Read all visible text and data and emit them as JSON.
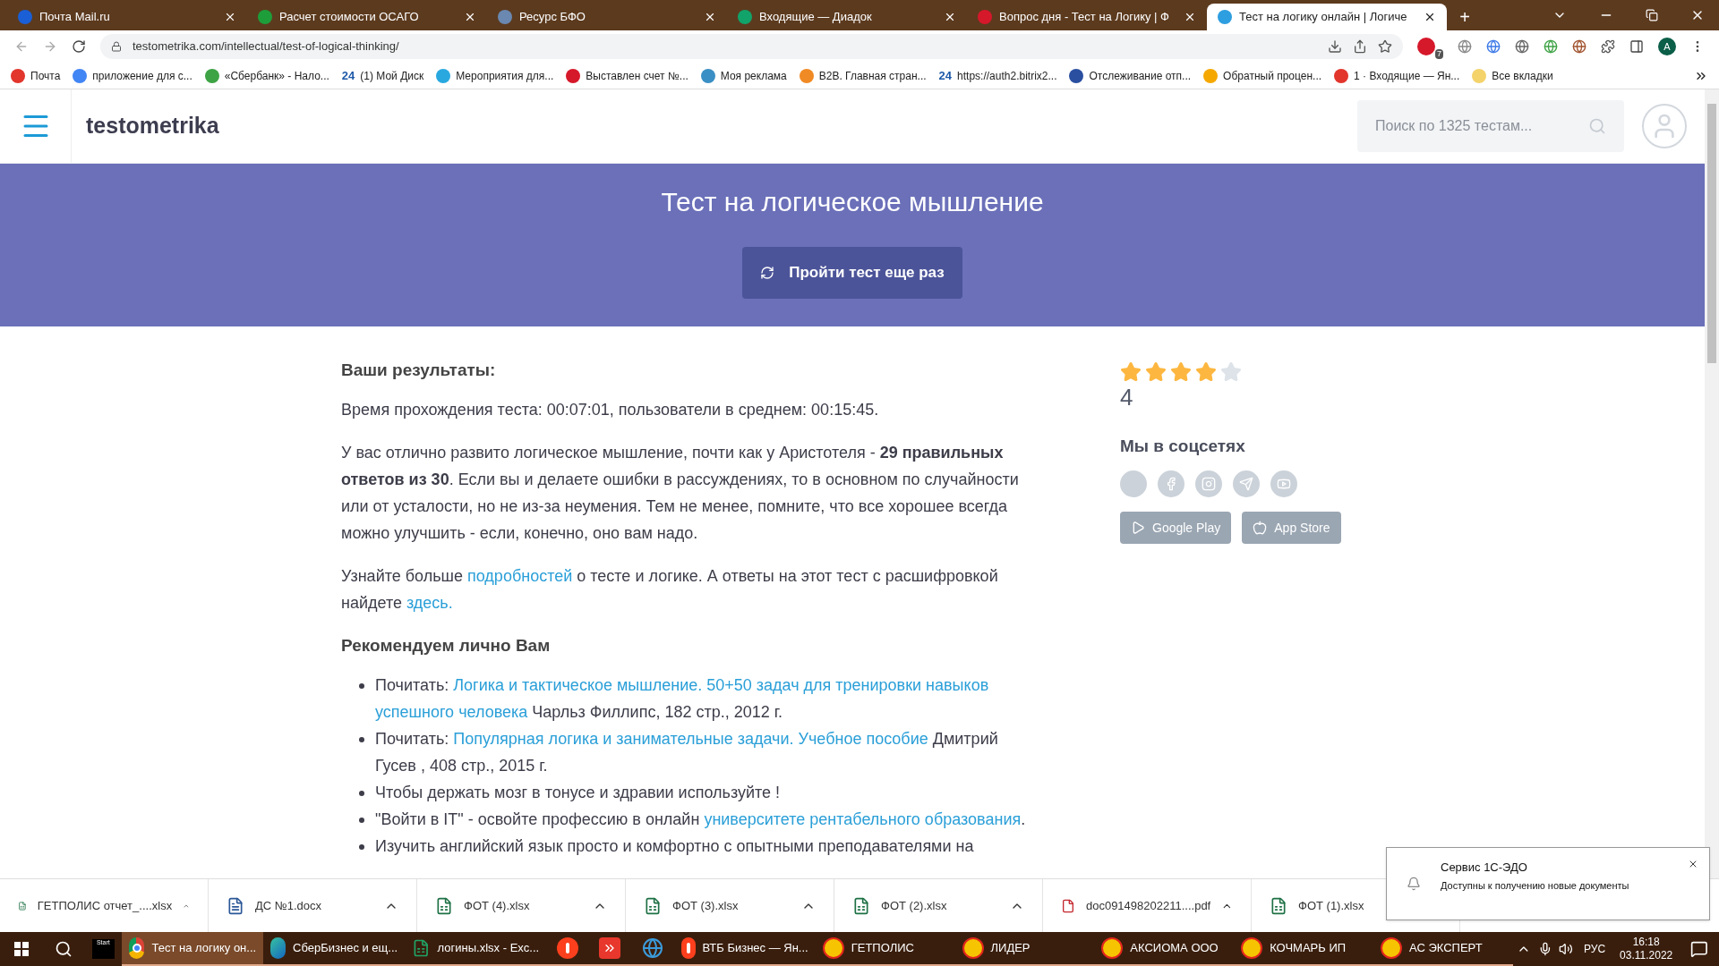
{
  "browser": {
    "tabs": [
      {
        "title": "Почта Mail.ru",
        "color": "#1a5fd6",
        "selected": false
      },
      {
        "title": "Расчет стоимости ОСАГО",
        "color": "#1e9e3a",
        "selected": false
      },
      {
        "title": "Ресурс БФО",
        "color": "#6a88b0",
        "selected": false
      },
      {
        "title": "Входящие — Диадок",
        "color": "#12a36a",
        "selected": false
      },
      {
        "title": "Вопрос дня - Тест на Логику | Ф",
        "color": "#d6182b",
        "selected": false
      },
      {
        "title": "Тест на логику онлайн | Логиче",
        "color": "#2d9ee0",
        "selected": true
      }
    ],
    "new_tab": "+",
    "url": "testometrika.com/intellectual/test-of-logical-thinking/",
    "profile": "A",
    "extension_badge": "7",
    "bookmarks": [
      {
        "label": "Почта",
        "color": "#e2352c"
      },
      {
        "label": "приложение для с...",
        "color": "#4285f4"
      },
      {
        "label": "«Сбербанк» - Нало...",
        "color": "#3da344"
      },
      {
        "label": "(1) Мой Диск",
        "color": "#1e5aa8",
        "glyph": "24"
      },
      {
        "label": "Мероприятия для...",
        "color": "#29a8e0"
      },
      {
        "label": "Выставлен счет №...",
        "color": "#d6182b"
      },
      {
        "label": "Моя реклама",
        "color": "#3a8fc4"
      },
      {
        "label": "B2B. Главная стран...",
        "color": "#f08a24"
      },
      {
        "label": "https://auth2.bitrix2...",
        "color": "#1e5aa8",
        "glyph": "24"
      },
      {
        "label": "Отслеживание отп...",
        "color": "#2a4fa0"
      },
      {
        "label": "Обратный процен...",
        "color": "#f5a800"
      },
      {
        "label": "1 · Входящие — Ян...",
        "color": "#e2352c"
      },
      {
        "label": "Все вкладки",
        "color": "#f4d36b"
      }
    ]
  },
  "site": {
    "logo": "testometrika",
    "search": {
      "placeholder": "Поиск по 1325 тестам..."
    },
    "banner": {
      "title": "Тест на логическое мышление",
      "button": "Пройти тест еще раз"
    },
    "results": {
      "heading": "Ваши результаты:",
      "time": "Время прохождения теста: 00:07:01, пользователи в среднем: 00:15:45.",
      "summary": "У вас отлично развито логическое мышление, почти как у Аристотеля - **29 правильных ответов из 30**. Если вы и делаете ошибки в рассуждениях, то в основном по случайности или от усталости, но не из-за неумения. Тем не менее, помните, что все хорошее всегда можно улучшить - если, конечно, оно вам надо.",
      "more": [
        {
          "text": "Узнайте больше "
        },
        {
          "text": "подробностей",
          "link": true
        },
        {
          "text": " о тесте и логике. А ответы на этот тест с расшифровкой найдете "
        },
        {
          "text": "здесь.",
          "link": true
        }
      ]
    },
    "recommend": {
      "heading": "Рекомендуем лично Вам",
      "items": [
        [
          {
            "text": "Почитать: "
          },
          {
            "text": "Логика и тактическое мышление. 50+50 задач для тренировки навыков ",
            "link": true
          },
          {
            "text": "успешного человека",
            "link": true
          },
          {
            "text": " Чарльз Филлипс, 182 стр., 2012 г."
          }
        ],
        [
          {
            "text": "Почитать: "
          },
          {
            "text": "Популярная логика и занимательные задачи. Учебное пособие",
            "link": true
          },
          {
            "text": " Дмитрий Гусев , 408 стр., 2015 г."
          }
        ],
        [
          {
            "text": "Чтобы держать мозг в тонусе и здравии используйте !"
          }
        ],
        [
          {
            "text": "\"Войти в IT\" - освойте профессию в онлайн "
          },
          {
            "text": "университете рентабельного образования",
            "link": true
          },
          {
            "text": "."
          }
        ],
        [
          {
            "text": "Изучить английский язык просто и комфортно с опытными преподавателями на"
          }
        ]
      ]
    },
    "sidebar": {
      "stars": 4,
      "rating": "4",
      "social_heading": "Мы в соцсетях",
      "store_buttons": [
        "Google Play",
        "App Store"
      ]
    }
  },
  "downloads": [
    {
      "name": "ГЕТПОЛИС отчет_....xlsx",
      "kind": "xlsx"
    },
    {
      "name": "ДС №1.docx",
      "kind": "docx"
    },
    {
      "name": "ФОТ (4).xlsx",
      "kind": "xlsx"
    },
    {
      "name": "ФОТ (3).xlsx",
      "kind": "xlsx"
    },
    {
      "name": "ФОТ (2).xlsx",
      "kind": "xlsx"
    },
    {
      "name": "doc091498202211....pdf",
      "kind": "pdf"
    },
    {
      "name": "ФОТ (1).xlsx",
      "kind": "xlsx"
    }
  ],
  "notification": {
    "title": "Сервис 1С-ЭДО",
    "body": "Доступны к получению новые документы"
  },
  "taskbar": {
    "start_app": "Start",
    "apps": [
      {
        "label": "Тест на логику он...",
        "kind": "chrome",
        "selected": true
      },
      {
        "label": "СберБизнес и ещ...",
        "kind": "edge",
        "selected": false
      },
      {
        "label": "логины.xlsx - Exc...",
        "kind": "excel",
        "selected": false
      },
      {
        "kind": "yandex",
        "selected": false
      },
      {
        "kind": "red",
        "selected": false
      },
      {
        "kind": "ie",
        "selected": false
      },
      {
        "label": "ВТБ Бизнес — Ян...",
        "kind": "yandex",
        "selected": false
      },
      {
        "label": "ГЕТПОЛИС",
        "kind": "onec",
        "selected": false
      },
      {
        "label": "ЛИДЕР",
        "kind": "onec",
        "selected": false
      },
      {
        "label": "АКСИОМА ООО",
        "kind": "onec",
        "selected": false
      },
      {
        "label": "КОЧМАРЬ ИП",
        "kind": "onec",
        "selected": false
      },
      {
        "label": "АС ЭКСПЕРТ",
        "kind": "onec",
        "selected": false
      }
    ],
    "language": "РУС",
    "time": "16:18",
    "date": "03.11.2022"
  }
}
